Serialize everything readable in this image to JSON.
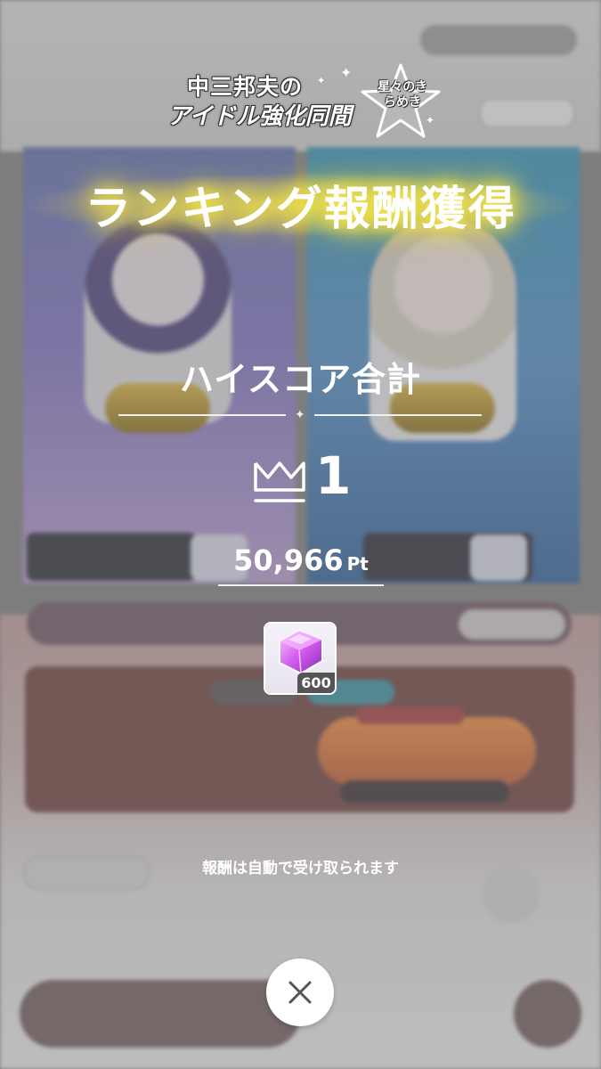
{
  "event": {
    "title_line1": "中三邦夫の",
    "title_line2": "アイドル強化同間",
    "subtitle": "星々のきらめき"
  },
  "modal": {
    "headline": "ランキング報酬獲得",
    "category": "ハイスコア合計",
    "rank": "1",
    "score": "50,966",
    "score_unit": "Pt",
    "notice": "報酬は自動で受け取られます",
    "close_icon": "close-icon"
  },
  "reward": {
    "icon": "gem-icon",
    "quantity": "600"
  },
  "colors": {
    "headline_glow": "#f3e24a",
    "text": "#ffffff",
    "dim_overlay": "#7f7f7f"
  }
}
